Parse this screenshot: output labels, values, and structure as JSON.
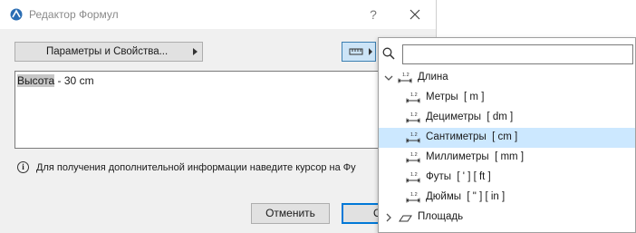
{
  "dialog": {
    "title": "Редактор Формул",
    "help_label": "?",
    "params_button_label": "Параметры и Свойства...",
    "editor": {
      "selected_text": "Высота",
      "rest_text": " - 30 cm"
    },
    "info_text": "Для получения дополнительной информации наведите курсор на Фу",
    "info_icon": "i",
    "cancel_label": "Отменить",
    "ok_label_partial": "О"
  },
  "popup": {
    "search_value": "",
    "items": [
      {
        "label": "Длина",
        "level": 0,
        "expanded": true,
        "icon": "length-unit-icon"
      },
      {
        "label": "Метры  [ m ]",
        "level": 1,
        "icon": "length-unit-icon"
      },
      {
        "label": "Дециметры  [ dm ]",
        "level": 1,
        "icon": "length-unit-icon"
      },
      {
        "label": "Сантиметры  [ cm ]",
        "level": 1,
        "selected": true,
        "icon": "length-unit-icon"
      },
      {
        "label": "Миллиметры  [ mm ]",
        "level": 1,
        "icon": "length-unit-icon"
      },
      {
        "label": "Футы  [ ' ] [ ft ]",
        "level": 1,
        "icon": "length-unit-icon"
      },
      {
        "label": "Дюймы  [ \" ] [ in ]",
        "level": 1,
        "icon": "length-unit-icon"
      },
      {
        "label": "Площадь",
        "level": 0,
        "expanded": false,
        "icon": "area-unit-icon"
      }
    ]
  },
  "colors": {
    "selection_highlight": "#cce8ff",
    "units_button_bg": "#cce4f7",
    "ok_button_border": "#0078d7"
  }
}
